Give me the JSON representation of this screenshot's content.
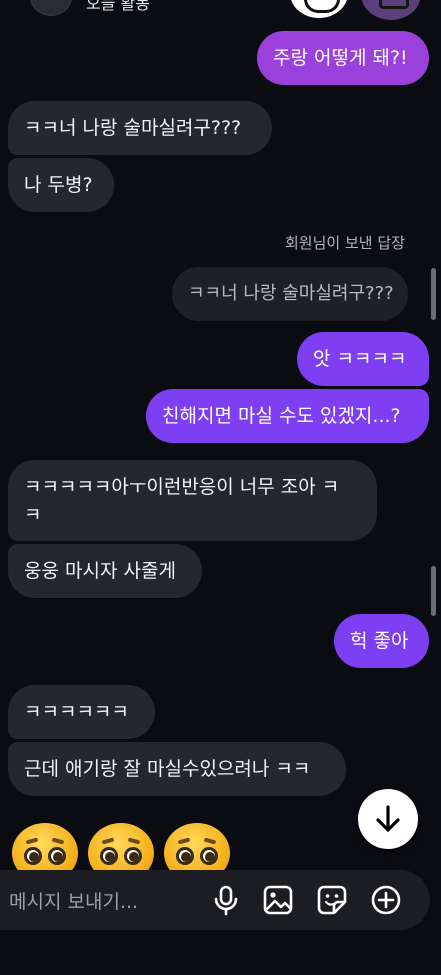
{
  "header": {
    "status": "오늘 활동"
  },
  "messages": [
    {
      "id": "m1",
      "side": "out",
      "text": "주랑 어떻게 돼?!"
    },
    {
      "id": "m2",
      "side": "in",
      "text": "ㅋㅋ너 나랑 술마실려구???"
    },
    {
      "id": "m3",
      "side": "in",
      "text": "나 두병?"
    },
    {
      "id": "m4",
      "side": "out",
      "text": "앗 ㅋㅋㅋㅋ"
    },
    {
      "id": "m5",
      "side": "out",
      "text": "친해지면 마실 수도 있겠지...?"
    },
    {
      "id": "m6",
      "side": "in",
      "text_line1": "ㅋㅋㅋㅋㅋ아ㅜ이런반응이 너무 조아 ㅋ",
      "text_line2": "ㅋ"
    },
    {
      "id": "m7",
      "side": "in",
      "text": "웅웅 마시자 사줄게"
    },
    {
      "id": "m8",
      "side": "out",
      "text": "헉 좋아"
    },
    {
      "id": "m9",
      "side": "in",
      "text": "ㅋㅋㅋㅋㅋㅋ"
    },
    {
      "id": "m10",
      "side": "in",
      "text": "근데 애기랑 잘 마실수있으려나 ㅋㅋ"
    }
  ],
  "reply": {
    "label": "회원님이 보낸 답장",
    "quoted_text": "ㅋㅋ너 나랑 술마실려구???"
  },
  "emoji_reaction": {
    "name": "pleading-face",
    "count": 3
  },
  "composer": {
    "placeholder": "메시지 보내기...",
    "icons": [
      "microphone-icon",
      "image-icon",
      "sticker-icon",
      "plus-circle-icon"
    ]
  },
  "colors": {
    "background": "#0b0c11",
    "incoming_bubble": "#25272e",
    "outgoing_bubble": "#7d3ff1",
    "outgoing_bubble_top": "#9a41dc",
    "quote_bubble": "#1e2026"
  }
}
